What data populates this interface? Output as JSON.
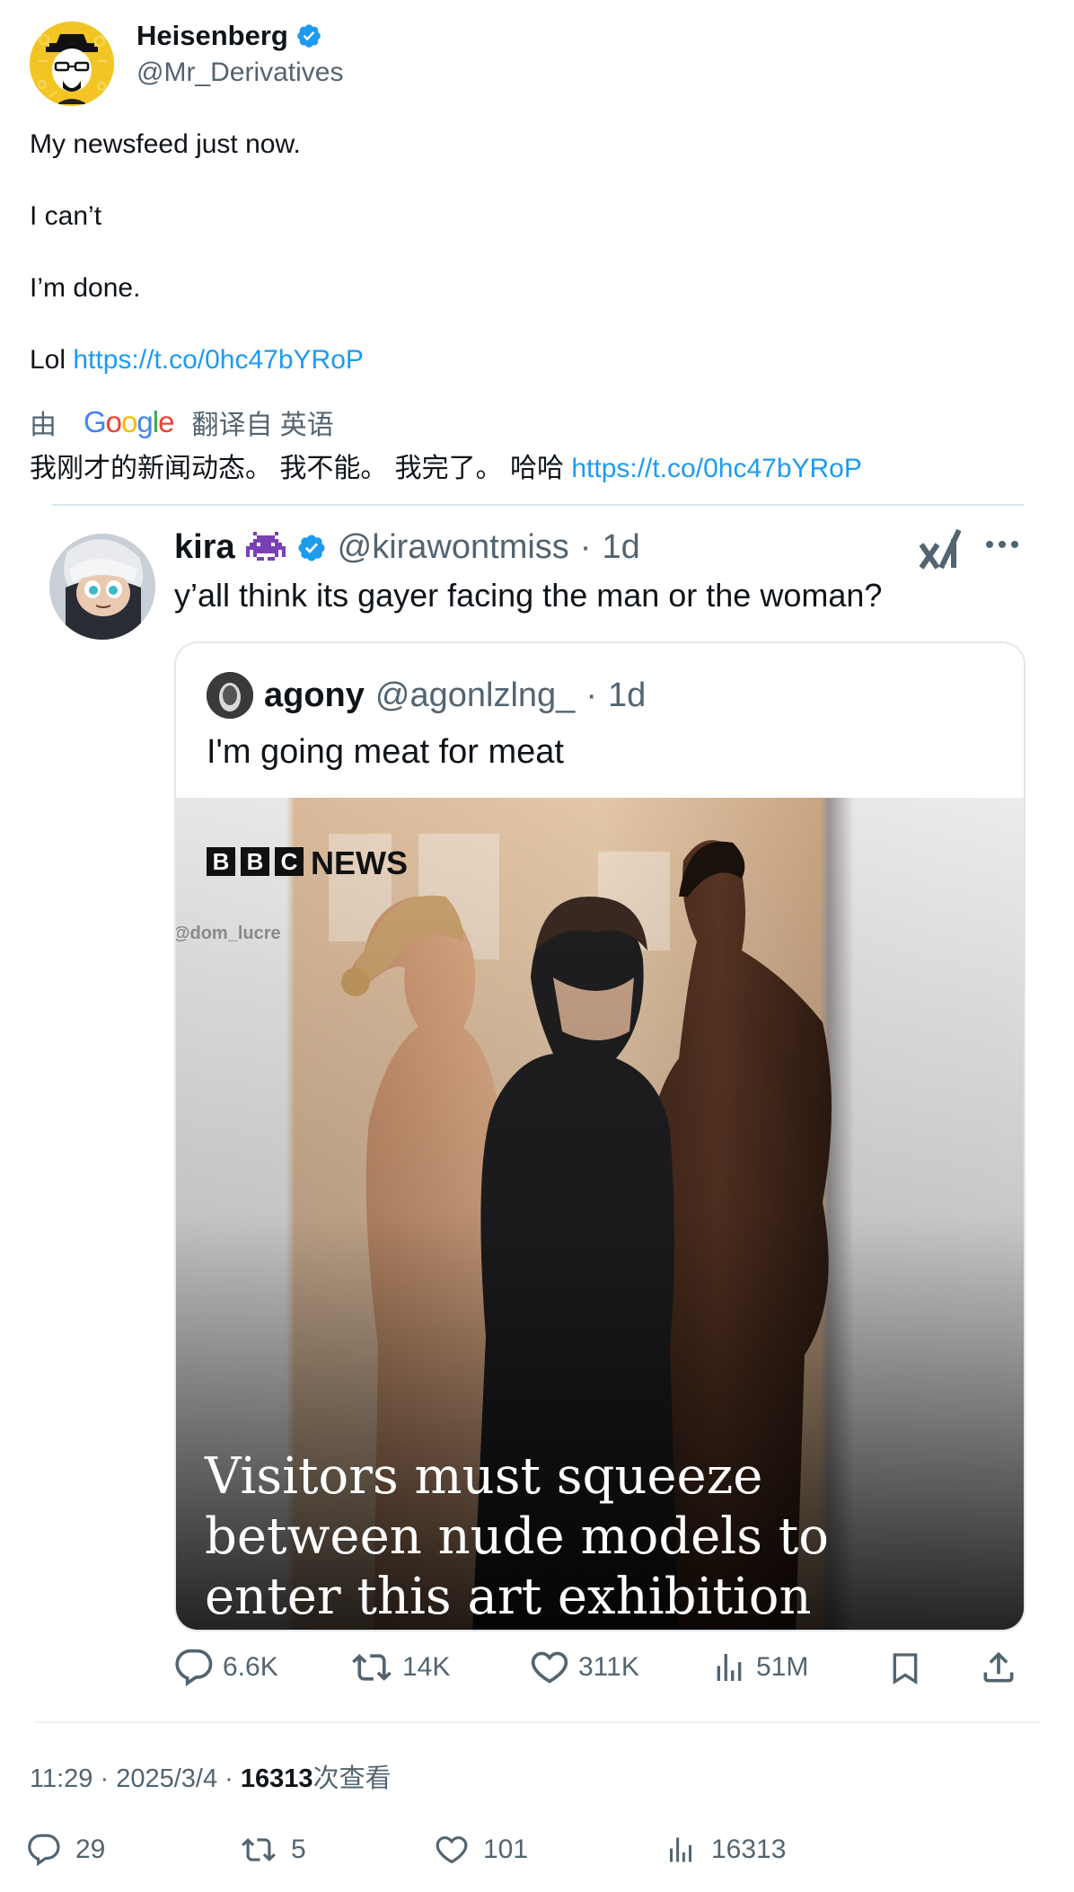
{
  "author": {
    "name": "Heisenberg",
    "handle": "@Mr_Derivatives"
  },
  "tweet": {
    "line1": "My newsfeed just now.",
    "line2": "I can’t",
    "line3": "I’m done.",
    "line4_prefix": "Lol ",
    "link": "https://t.co/0hc47bYRoP"
  },
  "translation": {
    "by": "由",
    "google": [
      "G",
      "o",
      "o",
      "g",
      "l",
      "e"
    ],
    "label": "翻译自 英语",
    "text": "我刚才的新闻动态。 我不能。 我完了。 哈哈 ",
    "link": "https://t.co/0hc47bYRoP"
  },
  "quoted": {
    "name": "kira",
    "handle": "@kirawontmiss",
    "dot": "·",
    "time": "1d",
    "text": "y’all think its gayer facing the man or the woman?",
    "nested": {
      "name": "agony",
      "handle": "@agonlzlng_",
      "dot": "·",
      "time": "1d",
      "text": "I'm going meat for meat",
      "image": {
        "brand_letters": [
          "B",
          "B",
          "C"
        ],
        "brand_word": "NEWS",
        "watermark": "@dom_lucre",
        "headline1": "Visitors must squeeze",
        "headline2": "between nude models to",
        "headline3": "enter this art exhibition"
      }
    },
    "actions": {
      "replies": "6.6K",
      "retweets": "14K",
      "likes": "311K",
      "views": "51M"
    }
  },
  "meta": {
    "time": "11:29",
    "sep": "·",
    "date": "2025/3/4",
    "views_num": "16313",
    "views_label": "次查看"
  },
  "stats": {
    "replies": "29",
    "retweets": "5",
    "likes": "101",
    "views": "16313"
  },
  "colors": {
    "link": "#1d9bf0",
    "verified": "#1d9bf0",
    "muted": "#536471"
  }
}
